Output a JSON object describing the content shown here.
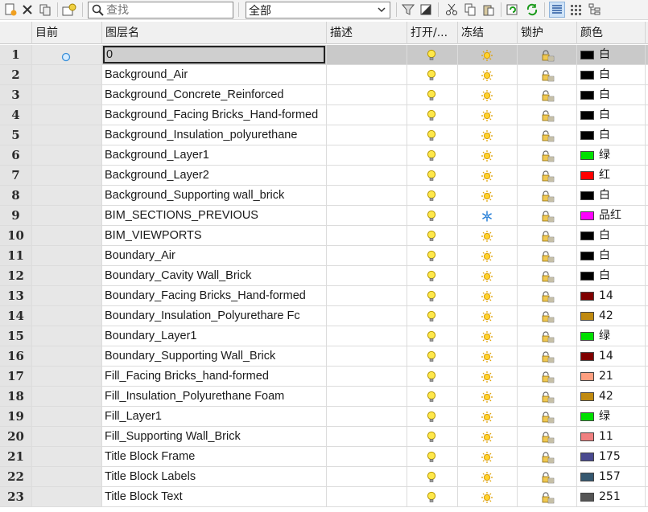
{
  "toolbar": {
    "search_placeholder": "查找",
    "filter_value": "全部"
  },
  "columns": [
    "目前",
    "图层名",
    "描述",
    "打开/...",
    "冻结",
    "锁护",
    "颜色"
  ],
  "layers": [
    {
      "num": "1",
      "name": "0",
      "color_name": "白",
      "color_hex": "#000000",
      "frozen": false,
      "current": true
    },
    {
      "num": "2",
      "name": "Background_Air",
      "color_name": "白",
      "color_hex": "#000000",
      "frozen": false
    },
    {
      "num": "3",
      "name": "Background_Concrete_Reinforced",
      "color_name": "白",
      "color_hex": "#000000",
      "frozen": false
    },
    {
      "num": "4",
      "name": "Background_Facing Bricks_Hand-formed",
      "color_name": "白",
      "color_hex": "#000000",
      "frozen": false
    },
    {
      "num": "5",
      "name": "Background_Insulation_polyurethane",
      "color_name": "白",
      "color_hex": "#000000",
      "frozen": false
    },
    {
      "num": "6",
      "name": "Background_Layer1",
      "color_name": "绿",
      "color_hex": "#00e000",
      "frozen": false
    },
    {
      "num": "7",
      "name": "Background_Layer2",
      "color_name": "红",
      "color_hex": "#ff0000",
      "frozen": false
    },
    {
      "num": "8",
      "name": "Background_Supporting wall_brick",
      "color_name": "白",
      "color_hex": "#000000",
      "frozen": false
    },
    {
      "num": "9",
      "name": "BIM_SECTIONS_PREVIOUS",
      "color_name": "品红",
      "color_hex": "#ff00ff",
      "frozen": true
    },
    {
      "num": "10",
      "name": "BIM_VIEWPORTS",
      "color_name": "白",
      "color_hex": "#000000",
      "frozen": false
    },
    {
      "num": "11",
      "name": "Boundary_Air",
      "color_name": "白",
      "color_hex": "#000000",
      "frozen": false
    },
    {
      "num": "12",
      "name": "Boundary_Cavity Wall_Brick",
      "color_name": "白",
      "color_hex": "#000000",
      "frozen": false
    },
    {
      "num": "13",
      "name": "Boundary_Facing Bricks_Hand-formed",
      "color_name": "14",
      "color_hex": "#800000",
      "frozen": false
    },
    {
      "num": "14",
      "name": "Boundary_Insulation_Polyurethare Fc",
      "color_name": "42",
      "color_hex": "#c08a10",
      "frozen": false
    },
    {
      "num": "15",
      "name": "Boundary_Layer1",
      "color_name": "绿",
      "color_hex": "#00e000",
      "frozen": false
    },
    {
      "num": "16",
      "name": "Boundary_Supporting Wall_Brick",
      "color_name": "14",
      "color_hex": "#800000",
      "frozen": false
    },
    {
      "num": "17",
      "name": "Fill_Facing Bricks_hand-formed",
      "color_name": "21",
      "color_hex": "#ff9f80",
      "frozen": false
    },
    {
      "num": "18",
      "name": "Fill_Insulation_Polyurethane Foam",
      "color_name": "42",
      "color_hex": "#c08a10",
      "frozen": false
    },
    {
      "num": "19",
      "name": "Fill_Layer1",
      "color_name": "绿",
      "color_hex": "#00e000",
      "frozen": false
    },
    {
      "num": "20",
      "name": "Fill_Supporting Wall_Brick",
      "color_name": "11",
      "color_hex": "#f08080",
      "frozen": false
    },
    {
      "num": "21",
      "name": "Title Block Frame",
      "color_name": "175",
      "color_hex": "#4a4a90",
      "frozen": false
    },
    {
      "num": "22",
      "name": "Title Block Labels",
      "color_name": "157",
      "color_hex": "#355870",
      "frozen": false
    },
    {
      "num": "23",
      "name": "Title Block Text",
      "color_name": "251",
      "color_hex": "#555555",
      "frozen": false
    }
  ]
}
